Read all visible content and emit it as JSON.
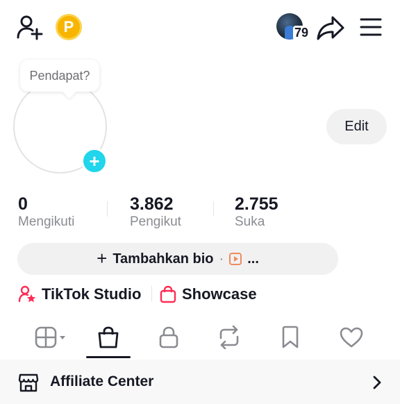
{
  "header": {
    "visitor_count": "79"
  },
  "profile": {
    "note_bubble": "Pendapat?",
    "edit_label": "Edit"
  },
  "stats": [
    {
      "value": "0",
      "label": "Mengikuti"
    },
    {
      "value": "3.862",
      "label": "Pengikut"
    },
    {
      "value": "2.755",
      "label": "Suka"
    }
  ],
  "bio": {
    "plus": "+",
    "label": "Tambahkan bio",
    "dot": "·",
    "ellipsis": "..."
  },
  "links": {
    "studio_label": "TikTok Studio",
    "showcase_label": "Showcase"
  },
  "tabs": [
    {
      "icon": "grid-icon"
    },
    {
      "icon": "shopping-bag-icon",
      "active": true
    },
    {
      "icon": "lock-icon"
    },
    {
      "icon": "repost-icon"
    },
    {
      "icon": "bookmark-icon"
    },
    {
      "icon": "heart-icon"
    }
  ],
  "affiliate": {
    "label": "Affiliate Center"
  },
  "colors": {
    "accent_cyan": "#20d5ec",
    "coin": "#f7b500",
    "studio_pink": "#fe2c55",
    "text": "#161823",
    "muted": "#8a8b91"
  }
}
